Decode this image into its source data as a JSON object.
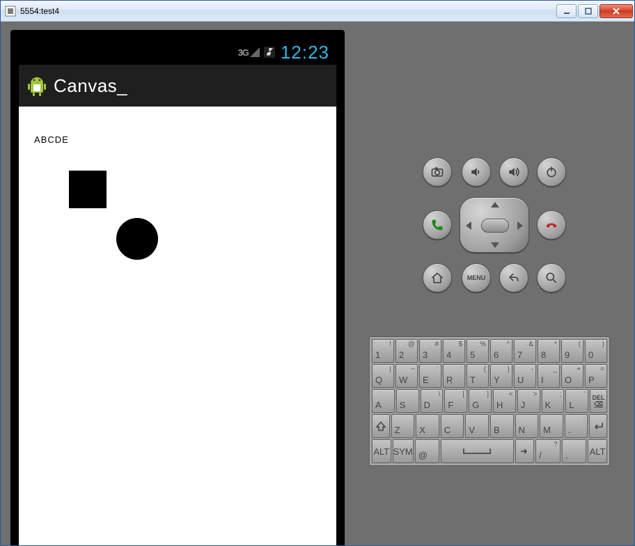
{
  "window": {
    "title": "5554:test4"
  },
  "status": {
    "network_label": "3G",
    "time": "12:23"
  },
  "app": {
    "title": "Canvas_"
  },
  "canvas": {
    "text": "ABCDE"
  },
  "hw": {
    "menu_label": "MENU"
  },
  "keyboard": {
    "row1": [
      {
        "m": "1",
        "a": "!"
      },
      {
        "m": "2",
        "a": "@"
      },
      {
        "m": "3",
        "a": "#"
      },
      {
        "m": "4",
        "a": "$"
      },
      {
        "m": "5",
        "a": "%"
      },
      {
        "m": "6",
        "a": "^"
      },
      {
        "m": "7",
        "a": "&"
      },
      {
        "m": "8",
        "a": "*"
      },
      {
        "m": "9",
        "a": "("
      },
      {
        "m": "0",
        "a": ")"
      }
    ],
    "row2": [
      {
        "m": "Q",
        "a": "|"
      },
      {
        "m": "W",
        "a": "~"
      },
      {
        "m": "E",
        "a": "`"
      },
      {
        "m": "R",
        "a": "`"
      },
      {
        "m": "T",
        "a": "{"
      },
      {
        "m": "Y",
        "a": "}"
      },
      {
        "m": "U",
        "a": "-"
      },
      {
        "m": "I",
        "a": "_"
      },
      {
        "m": "O",
        "a": "+"
      },
      {
        "m": "P",
        "a": "="
      }
    ],
    "row3": [
      {
        "m": "A",
        "a": ""
      },
      {
        "m": "S",
        "a": ""
      },
      {
        "m": "D",
        "a": "\\"
      },
      {
        "m": "F",
        "a": "["
      },
      {
        "m": "G",
        "a": "]"
      },
      {
        "m": "H",
        "a": "<"
      },
      {
        "m": "J",
        "a": ">"
      },
      {
        "m": "K",
        "a": ";"
      },
      {
        "m": "L",
        "a": "'"
      }
    ],
    "row3_del_top": "DEL",
    "row3_del_bot": "⌫",
    "row4": [
      {
        "m": "Z",
        "a": ""
      },
      {
        "m": "X",
        "a": ""
      },
      {
        "m": "C",
        "a": ""
      },
      {
        "m": "V",
        "a": ""
      },
      {
        "m": "B",
        "a": ""
      },
      {
        "m": "N",
        "a": ""
      },
      {
        "m": "M",
        "a": ""
      },
      {
        "m": ".",
        "a": ":"
      }
    ],
    "row5": {
      "alt_l": "ALT",
      "sym": "SYM",
      "at": "@",
      "comma": ",",
      "slash_main": "/",
      "slash_alt": "?",
      "alt_r": "ALT"
    }
  }
}
